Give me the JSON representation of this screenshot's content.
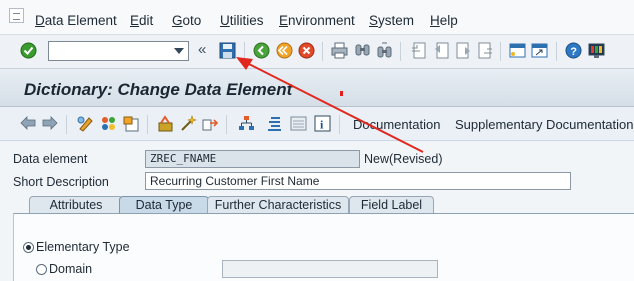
{
  "menu": {
    "items": [
      "Data Element",
      "Edit",
      "Goto",
      "Utilities",
      "Environment",
      "System",
      "Help"
    ]
  },
  "toolbar": {
    "command_field_value": "",
    "icons": [
      "check-icon",
      "save-icon",
      "back-icon",
      "exit-icon",
      "cancel-icon",
      "print-icon",
      "find-icon",
      "find-next-icon",
      "first-page-icon",
      "previous-page-icon",
      "next-page-icon",
      "last-page-icon",
      "new-session-icon",
      "shortcut-icon",
      "help-icon",
      "customize-layout-icon"
    ]
  },
  "title": "Dictionary: Change Data Element",
  "app_toolbar": {
    "documentation_label": "Documentation",
    "supplementary_label": "Supplementary Documentation"
  },
  "form": {
    "data_element_label": "Data element",
    "data_element_value": "ZREC_FNAME",
    "status_text": "New(Revised)",
    "short_description_label": "Short Description",
    "short_description_value": "Recurring Customer First Name"
  },
  "tabs": [
    {
      "label": "Attributes",
      "active": false
    },
    {
      "label": "Data Type",
      "active": true
    },
    {
      "label": "Further Characteristics",
      "active": false
    },
    {
      "label": "Field Label",
      "active": false
    }
  ],
  "data_type": {
    "elementary_type_label": "Elementary Type",
    "elementary_selected": true,
    "domain_label": "Domain",
    "domain_value": ""
  },
  "colors": {
    "annotation_arrow": "#e0281f",
    "title_bar": "#d5dee7"
  }
}
